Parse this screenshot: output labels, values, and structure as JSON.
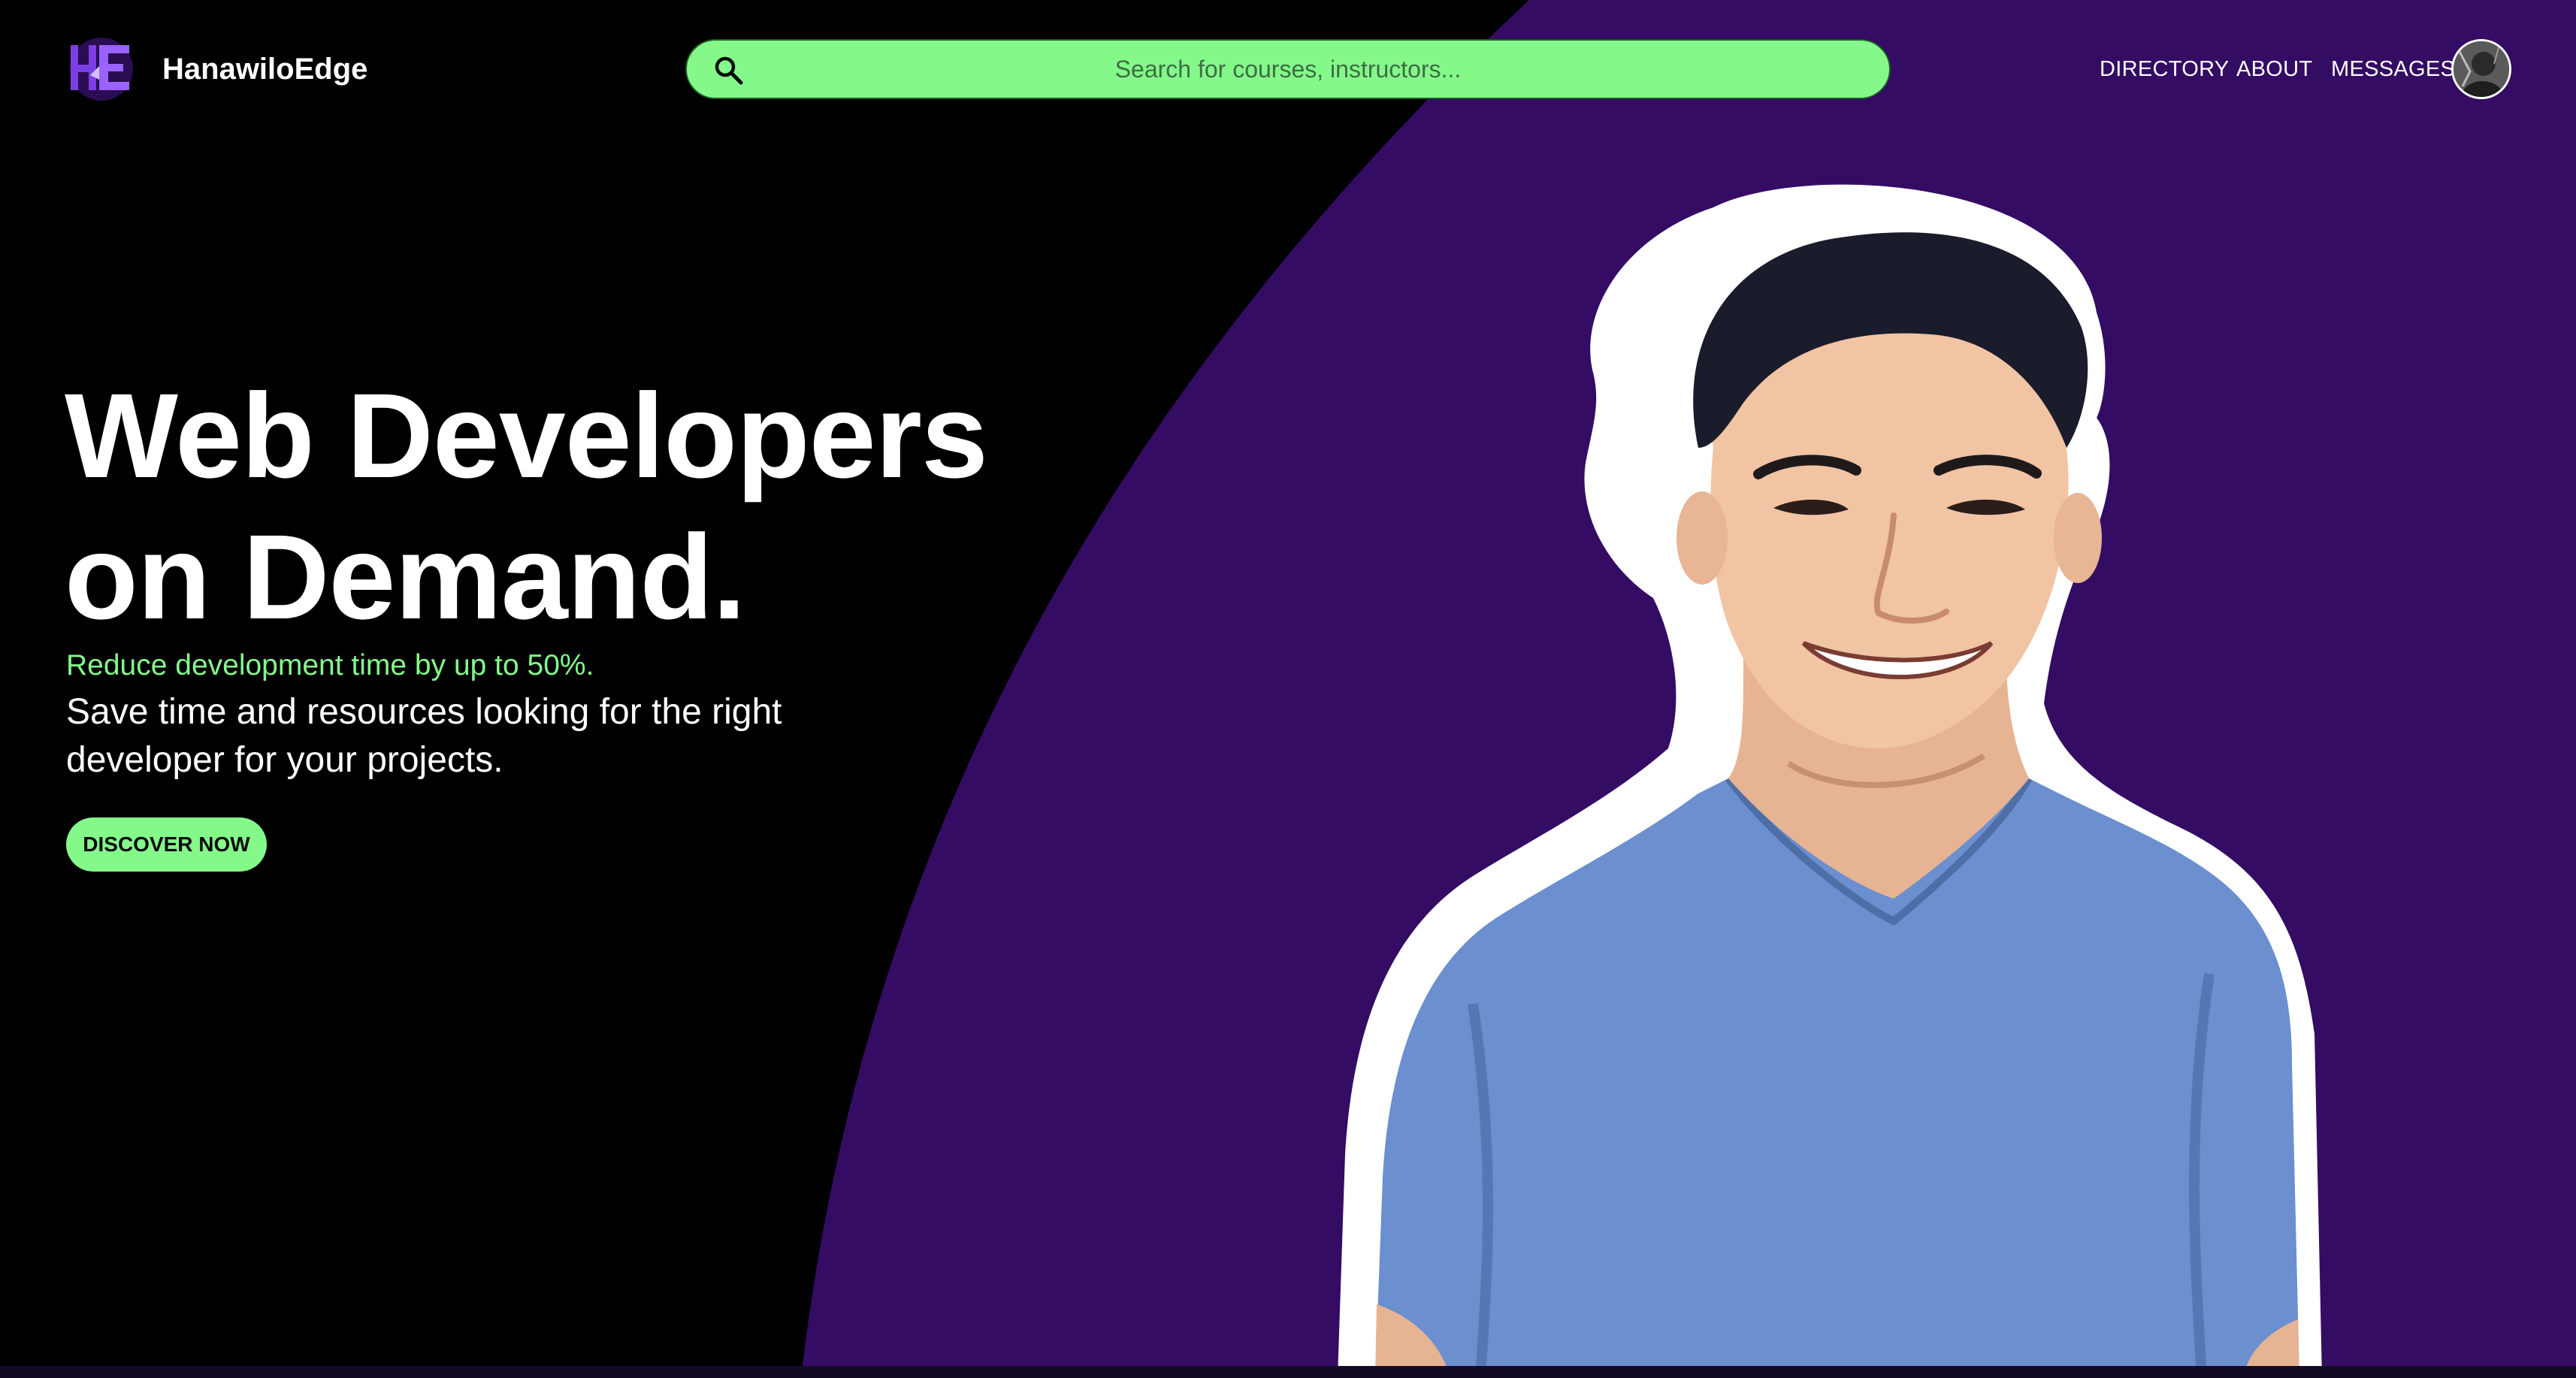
{
  "header": {
    "brand_name": "HanawiloEdge",
    "logo_letters": "HE",
    "search": {
      "placeholder": "Search for courses, instructors...",
      "value": ""
    },
    "nav": [
      {
        "label": "DIRECTORY"
      },
      {
        "label": "ABOUT"
      },
      {
        "label": "MESSAGES"
      }
    ]
  },
  "hero": {
    "title_line1": "Web Developers",
    "title_line2": "on Demand.",
    "accent": "Reduce development time by up to 50%.",
    "description": "Save time and resources looking for the right developer for your projects.",
    "cta_label": "DISCOVER NOW"
  },
  "colors": {
    "background": "#000000",
    "purple_panel": "#340c63",
    "accent_green": "#84f98a",
    "logo_purple": "#7b3fe4",
    "text": "#ffffff",
    "shirt_blue": "#6b8fcf"
  },
  "icons": {
    "search": "search-icon",
    "logo": "hanawiloedge-logo",
    "avatar": "user-avatar"
  }
}
